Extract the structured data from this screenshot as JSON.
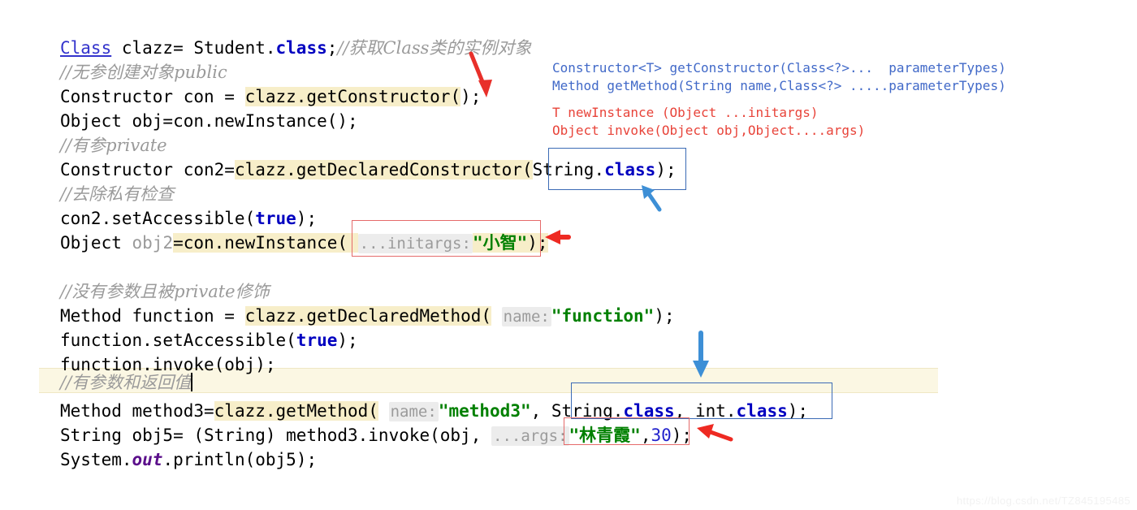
{
  "editor": {
    "language": "java",
    "background": "#ffffff",
    "default_text_color": "#000000",
    "highlight_color": "#f7eec9",
    "current_line_color": "#fbf7e3",
    "lines": [
      {
        "id": "line-1",
        "text": "Class clazz= Student.class;//获取Class类的实例对象"
      },
      {
        "id": "line-2",
        "text": "//无参创建对象public"
      },
      {
        "id": "line-3",
        "text": "Constructor con = clazz.getConstructor();"
      },
      {
        "id": "line-4",
        "text": "Object obj=con.newInstance();"
      },
      {
        "id": "line-5",
        "text": "//有参private"
      },
      {
        "id": "line-6",
        "text": "Constructor con2=clazz.getDeclaredConstructor(String.class);"
      },
      {
        "id": "line-7",
        "text": "//去除私有检查"
      },
      {
        "id": "line-8",
        "text": "con2.setAccessible(true);"
      },
      {
        "id": "line-9",
        "text": "Object obj2=con.newInstance( ...initargs: \"小智\");"
      },
      {
        "id": "line-10",
        "text": ""
      },
      {
        "id": "line-11",
        "text": "//没有参数且被private修饰"
      },
      {
        "id": "line-12",
        "text": "Method function = clazz.getDeclaredMethod( name: \"function\");"
      },
      {
        "id": "line-13",
        "text": "function.setAccessible(true);"
      },
      {
        "id": "line-14",
        "text": "function.invoke(obj);"
      },
      {
        "id": "line-15",
        "text": "//有参数和返回值"
      },
      {
        "id": "line-16",
        "text": "Method method3=clazz.getMethod( name: \"method3\", String.class, int.class);"
      },
      {
        "id": "line-17",
        "text": "String obj5= (String) method3.invoke(obj, ...args: \"林青霞\",30);"
      },
      {
        "id": "line-18",
        "text": "System.out.println(obj5);"
      }
    ],
    "tokens": {
      "l1_class_type": "Class",
      "l1_rest1": " clazz= Student.",
      "l1_class_kw": "class",
      "l1_semi": ";",
      "l1_comment": "//获取Class类的实例对象",
      "l2_comment": "//无参创建对象public",
      "l3_pre": "Constructor con = ",
      "l3_hl": "clazz.getConstructor(",
      "l3_post": ");",
      "l4_text": "Object obj=con.newInstance();",
      "l5_comment": "//有参private",
      "l6_pre": "Constructor con2=",
      "l6_hl": "clazz.getDeclaredConstructor(",
      "l6_str": "String.",
      "l6_kw": "class",
      "l6_post": ");",
      "l7_comment": "//去除私有检查",
      "l8_pre": "con2.setAccessible(",
      "l8_kw": "true",
      "l8_post": ");",
      "l9_pre": "Object ",
      "l9_var": "obj2",
      "l9_mid": "=con.newInstance( ",
      "l9_hint": "...initargs:",
      "l9_str": "\"小智\"",
      "l9_post": ");",
      "l11_comment": "//没有参数且被private修饰",
      "l12_pre": "Method function = ",
      "l12_hl": "clazz.getDeclaredMethod(",
      "l12_hint": "name:",
      "l12_str": "\"function\"",
      "l12_post": ");",
      "l13_pre": "function.setAccessible(",
      "l13_kw": "true",
      "l13_post": ");",
      "l14_text": "function.invoke(obj);",
      "l15_comment": "//有参数和返回值",
      "l16_pre": "Method method3=",
      "l16_hl": "clazz.getMethod(",
      "l16_hint": "name:",
      "l16_str": "\"method3\"",
      "l16_comma": ", ",
      "l16_type1": "String.",
      "l16_kw1": "class",
      "l16_comma2": ", ",
      "l16_type2": "int.",
      "l16_kw2": "class",
      "l16_post": ");",
      "l17_pre": "String obj5= (String) method3.invoke(obj, ",
      "l17_hint": "...args:",
      "l17_str": "\"林青霞\"",
      "l17_comma": ",",
      "l17_num": "30",
      "l17_post": ");",
      "l18_pre": "System.",
      "l18_field": "out",
      "l18_post": ".println(obj5);"
    }
  },
  "annotations": {
    "api_notes_blue": [
      "Constructor<T> getConstructor(Class<?>...  parameterTypes)",
      "Method getMethod(String name,Class<?> .....parameterTypes)"
    ],
    "api_notes_red": [
      "T newInstance (Object ...initargs)",
      "Object invoke(Object obj,Object....args)"
    ],
    "colors": {
      "blue_note": "#4169c8",
      "red_note": "#e8443a",
      "blue_box": "#3b6bb5",
      "red_box": "#e56a6a",
      "blue_arrow": "#3d8fd6",
      "red_arrow": "#e8302a"
    },
    "boxes": [
      {
        "name": "string-class-box",
        "target": "String.class argument of getDeclaredConstructor",
        "color": "blue"
      },
      {
        "name": "initargs-box",
        "target": "...initargs: \"小智\" argument",
        "color": "red"
      },
      {
        "name": "param-types-box",
        "target": "String.class, int.class arguments of getMethod",
        "color": "blue"
      },
      {
        "name": "args-box",
        "target": "...args: \"林青霞\",30 arguments of invoke",
        "color": "red"
      }
    ],
    "arrows": [
      {
        "name": "arrow-to-getconstructor-parens",
        "color": "red",
        "direction": "down-right"
      },
      {
        "name": "arrow-to-string-class-box",
        "color": "blue",
        "direction": "up-left"
      },
      {
        "name": "arrow-to-initargs-box",
        "color": "red",
        "direction": "left"
      },
      {
        "name": "arrow-to-param-types-box",
        "color": "blue",
        "direction": "down"
      },
      {
        "name": "arrow-to-args-box",
        "color": "red",
        "direction": "up-left"
      }
    ]
  },
  "watermark": {
    "text": "https://blog.csdn.net/TZ845195485"
  }
}
